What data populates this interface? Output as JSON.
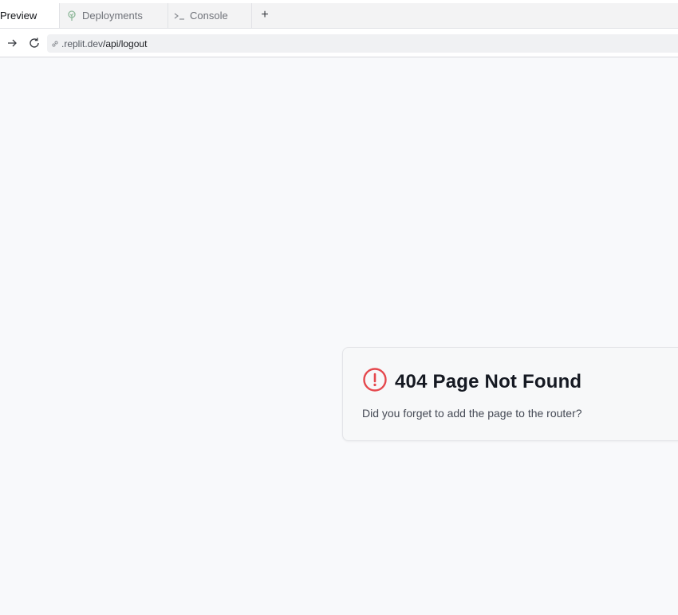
{
  "tabs": [
    {
      "label": "Preview",
      "icon": "none",
      "active": true
    },
    {
      "label": "Deployments",
      "icon": "deployments-tree-icon",
      "active": false
    },
    {
      "label": "Console",
      "icon": "terminal-icon",
      "active": false
    }
  ],
  "new_tab_label": "+",
  "address": {
    "host": ".replit.dev",
    "path": "/api/logout"
  },
  "error_card": {
    "icon": "alert-circle-icon",
    "title": "404 Page Not Found",
    "message": "Did you forget to add the page to the router?"
  },
  "colors": {
    "error": "#e5484d",
    "page_bg": "#f8f9fb"
  }
}
